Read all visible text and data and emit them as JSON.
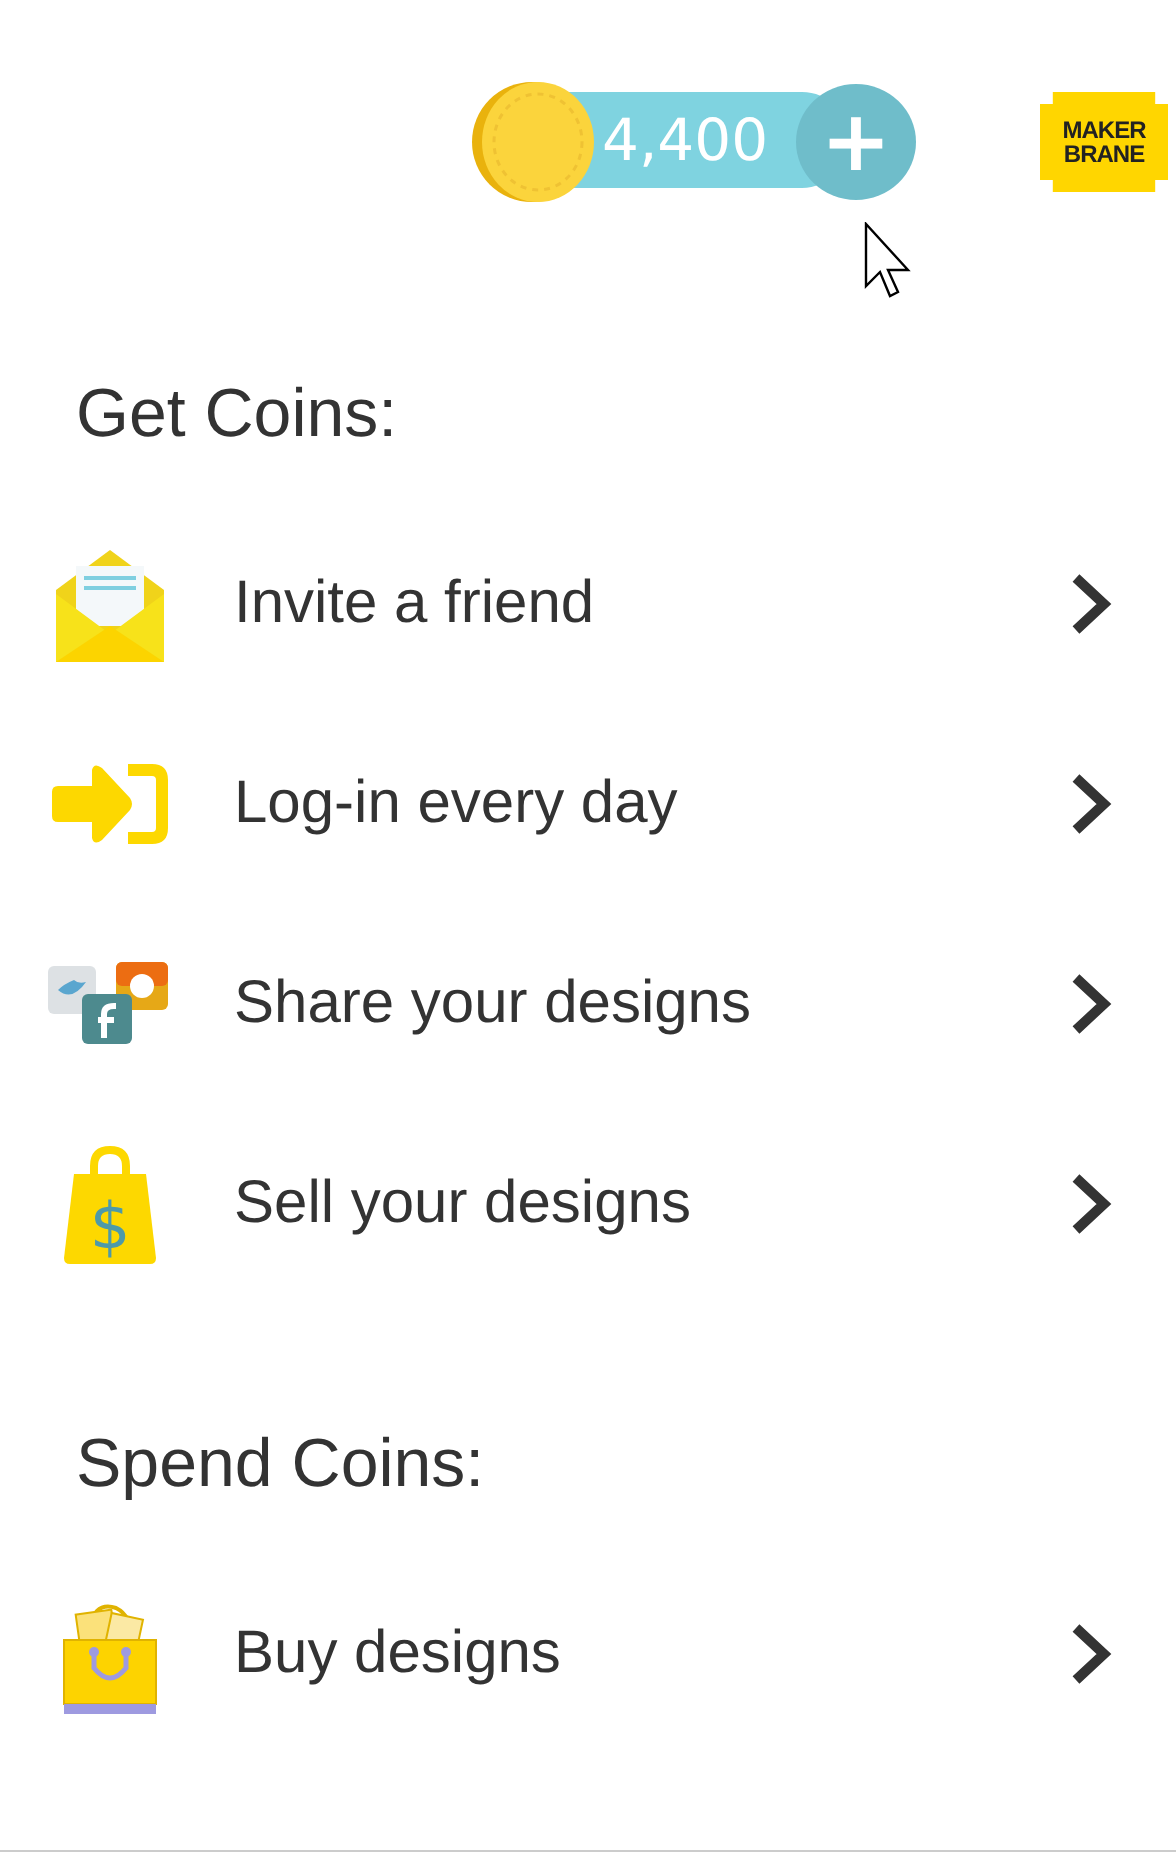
{
  "balance": {
    "amount": "4,400",
    "add_label": "+"
  },
  "logo": {
    "lines": [
      "MAKER",
      "BRANE"
    ]
  },
  "sections": [
    {
      "title": "Get Coins:",
      "items": [
        {
          "kind": "invite",
          "label": "Invite a friend"
        },
        {
          "kind": "login",
          "label": "Log-in every day"
        },
        {
          "kind": "share",
          "label": "Share your designs"
        },
        {
          "kind": "sell",
          "label": "Sell your designs",
          "icon_text": "$"
        }
      ]
    },
    {
      "title": "Spend Coins:",
      "items": [
        {
          "kind": "buy",
          "label": "Buy designs"
        }
      ]
    }
  ]
}
